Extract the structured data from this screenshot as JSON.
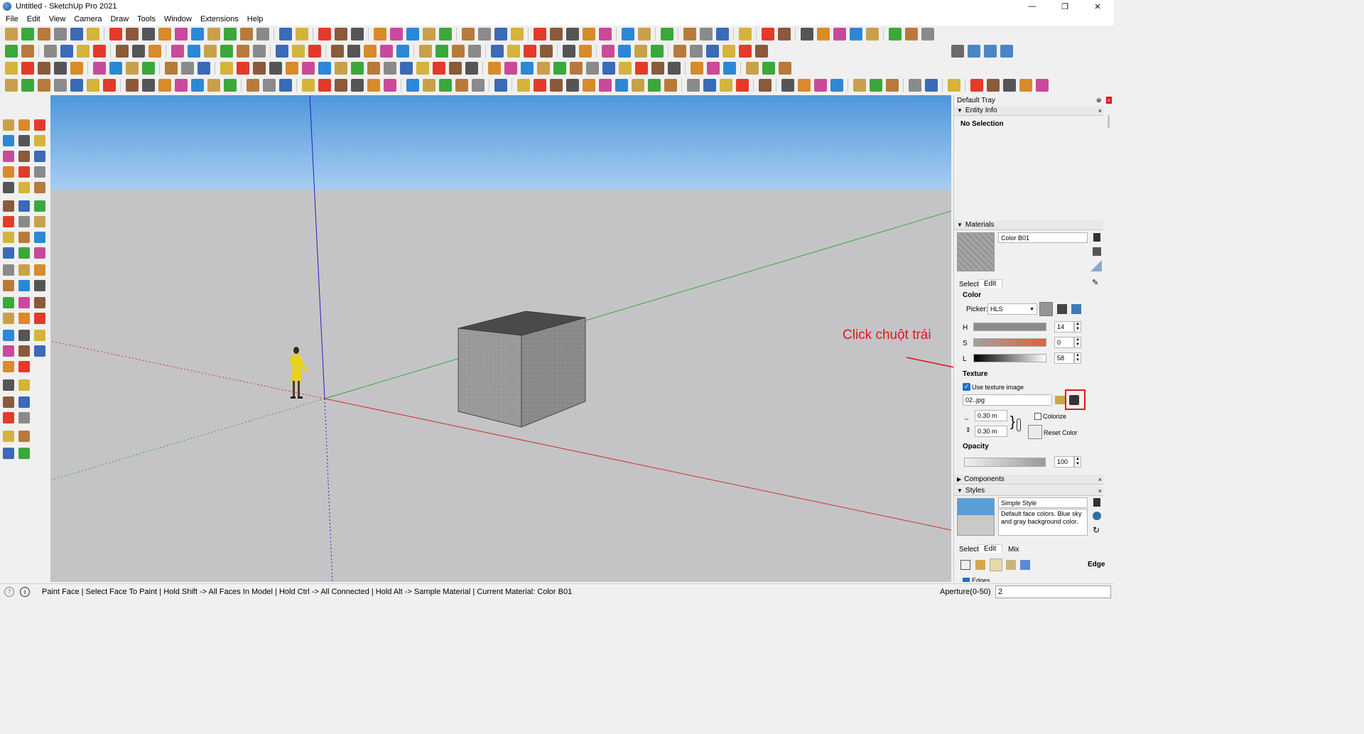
{
  "window": {
    "title": "Untitled - SketchUp Pro 2021",
    "controls": [
      "—",
      "❐",
      "✕"
    ]
  },
  "menu": [
    "File",
    "Edit",
    "View",
    "Camera",
    "Draw",
    "Tools",
    "Window",
    "Extensions",
    "Help"
  ],
  "annotation": {
    "text": "Click chuột trái",
    "color": "#e3141d"
  },
  "tray": {
    "title": "Default Tray",
    "entity_info": {
      "header": "Entity Info",
      "selection": "No Selection"
    },
    "materials": {
      "header": "Materials",
      "name": "Color B01",
      "tabs": [
        "Select",
        "Edit"
      ],
      "color_label": "Color",
      "picker_label": "Picker:",
      "picker_value": "HLS",
      "h_label": "H",
      "h_value": "14",
      "s_label": "S",
      "s_value": "0",
      "l_label": "L",
      "l_value": "58",
      "texture_label": "Texture",
      "use_texture_label": "Use texture image",
      "texture_file": "02..jpg",
      "width": "0.30 m",
      "height": "0.30 m",
      "colorize_label": "Colorize",
      "reset_color_label": "Reset Color",
      "opacity_label": "Opacity",
      "opacity_value": "100"
    },
    "components": {
      "header": "Components"
    },
    "styles": {
      "header": "Styles",
      "style_name": "Simple Style",
      "description": "Default face colors. Blue sky and gray background color.",
      "tabs": [
        "Select",
        "Edit",
        "Mix"
      ],
      "edge_label": "Edge",
      "edges_checkbox": "Edges"
    }
  },
  "status": {
    "message": "Paint Face | Select Face To Paint | Hold Shift -> All Faces In Model | Hold Ctrl -> All Connected | Hold Alt -> Sample Material | Current Material: Color B01",
    "aperture_label": "Aperture(0-50)",
    "aperture_value": "2"
  },
  "colors": {
    "sky": "#5c9edc",
    "ground": "#c4c4c6",
    "accent_red": "#e3141d",
    "axis_red": "#d0302c",
    "axis_green": "#3aa83a",
    "axis_blue": "#2020c0"
  }
}
